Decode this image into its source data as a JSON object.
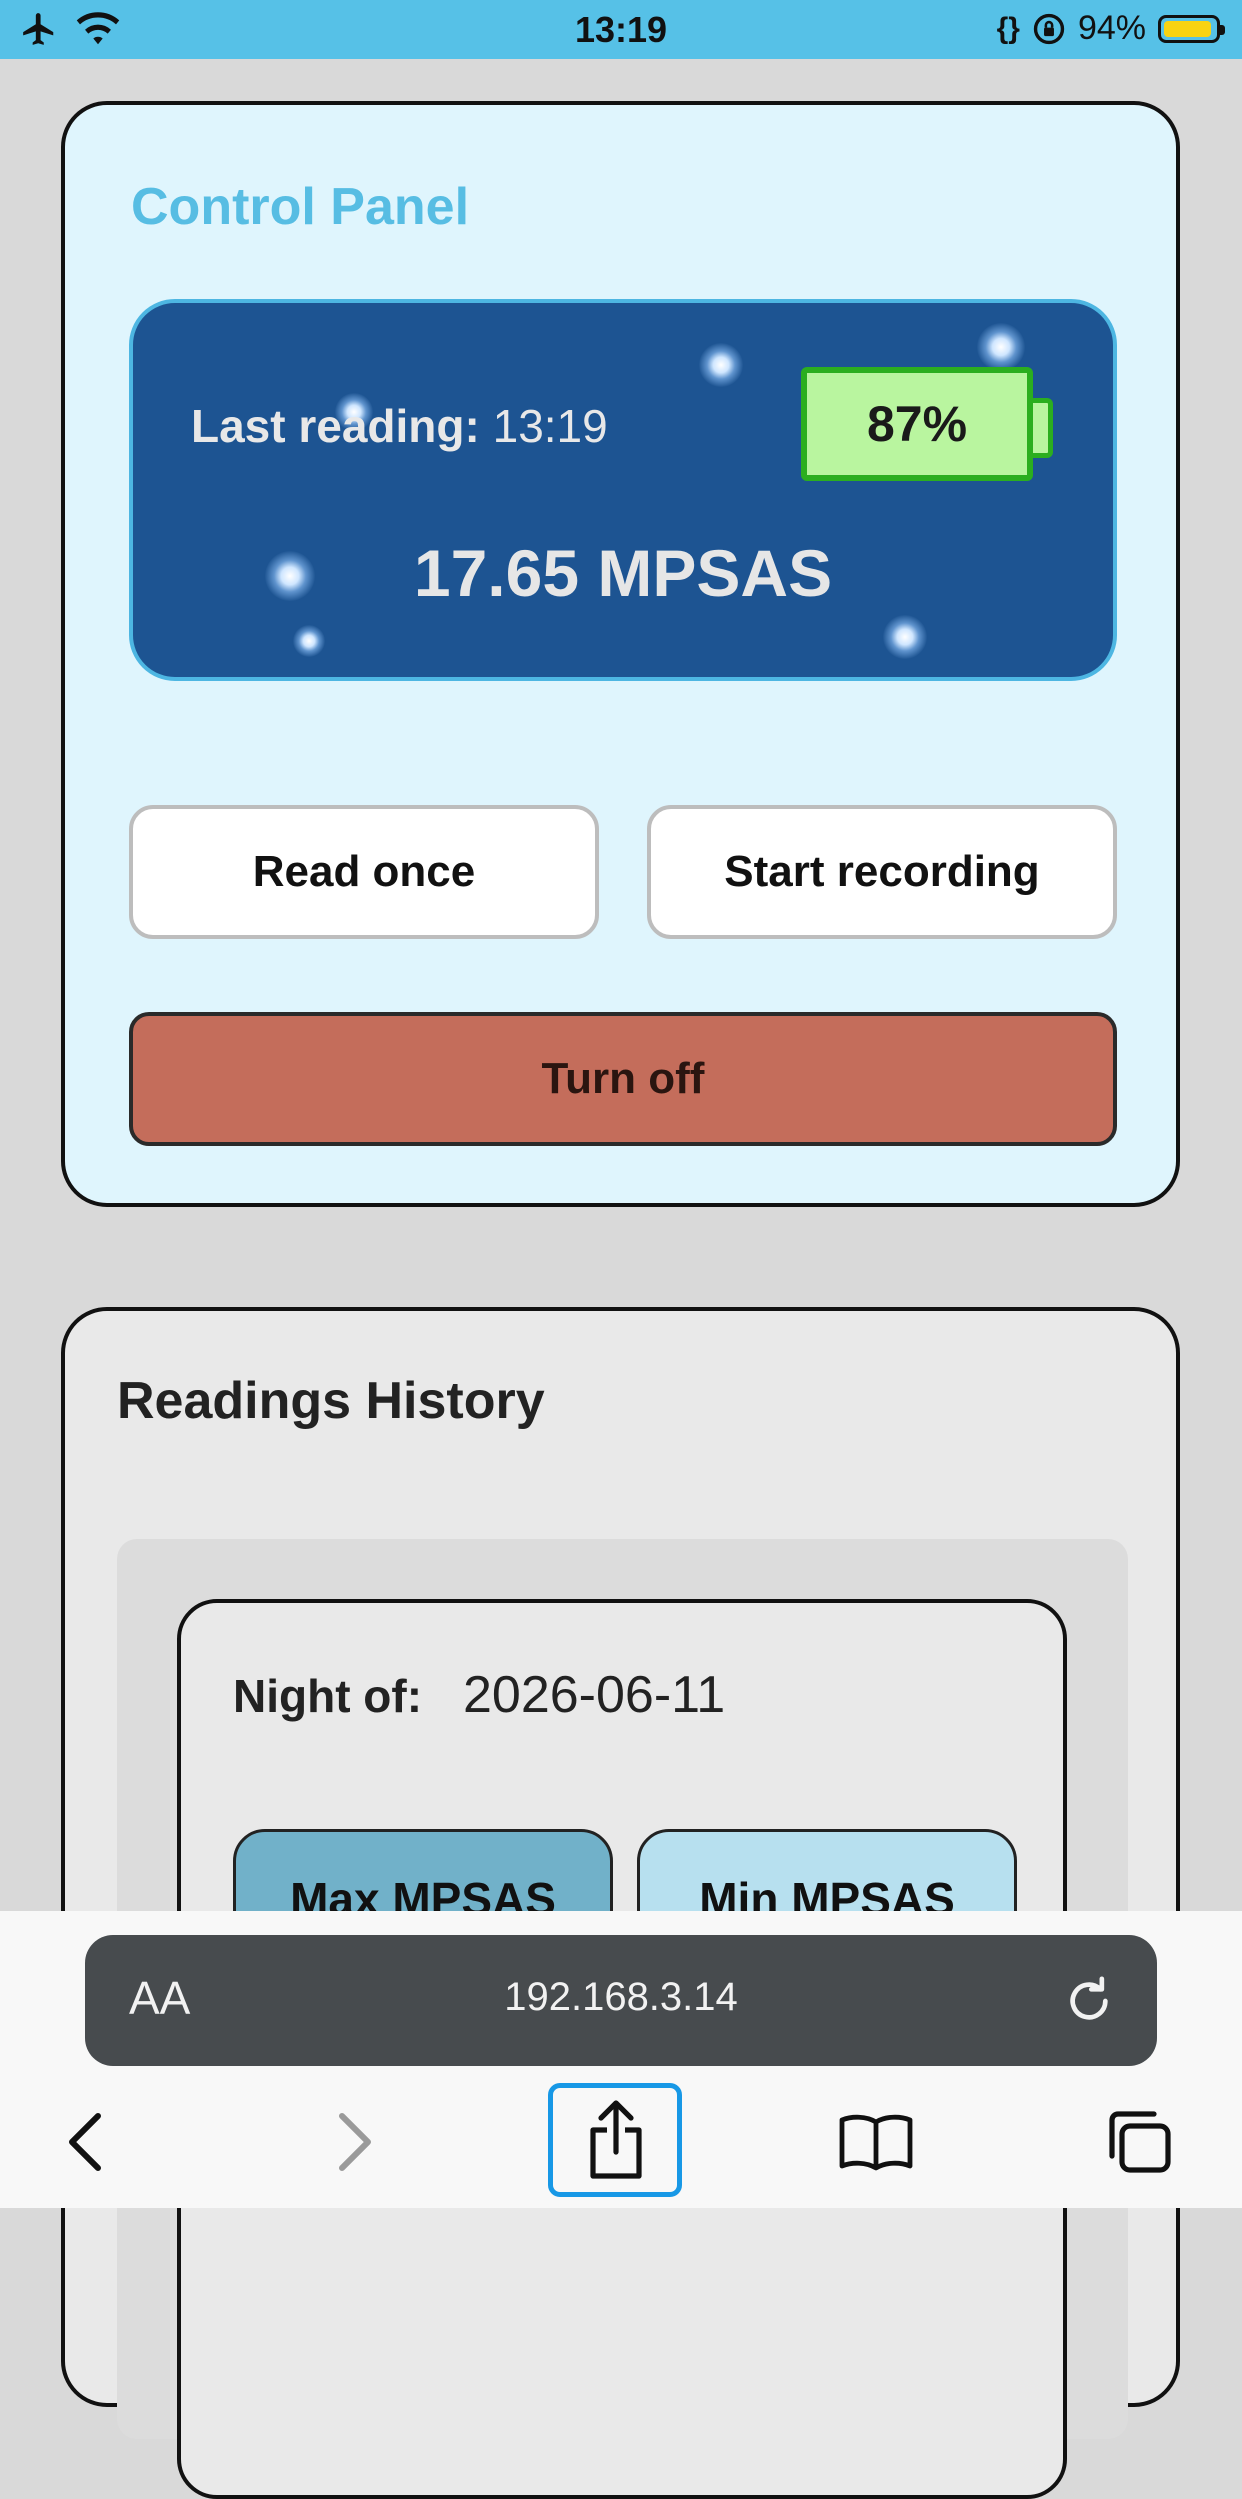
{
  "status_bar": {
    "time": "13:19",
    "battery_percent": "94%",
    "battery_level": 0.94,
    "icons": [
      "airplane-icon",
      "wifi-icon",
      "code-braces-icon",
      "rotation-lock-icon",
      "battery-icon"
    ]
  },
  "control_panel": {
    "title": "Control Panel",
    "last_reading_label": "Last reading:",
    "last_reading_time": "13:19",
    "device_battery": "87%",
    "device_battery_level": 0.87,
    "mpsas_value": "17.65 MPSAS",
    "read_once_label": "Read once",
    "start_recording_label": "Start recording",
    "turn_off_label": "Turn off"
  },
  "history": {
    "title": "Readings History",
    "night_label": "Night of:",
    "night_date": "2026-06-11",
    "max_label": "Max MPSAS",
    "min_label": "Min MPSAS"
  },
  "browser": {
    "text_size_label": "AA",
    "url": "192.168.3.14",
    "toolbar_icons": [
      "back-icon",
      "forward-icon",
      "share-icon",
      "bookmarks-icon",
      "tabs-icon"
    ]
  },
  "colors": {
    "status_bar": "#56c1e7",
    "panel_title": "#57bde3",
    "reading_box": "#1d5492",
    "battery_green": "#2bae1f",
    "turn_off": "#c46d5b",
    "max_button": "#71b1c9",
    "min_button": "#b7e0ef"
  }
}
